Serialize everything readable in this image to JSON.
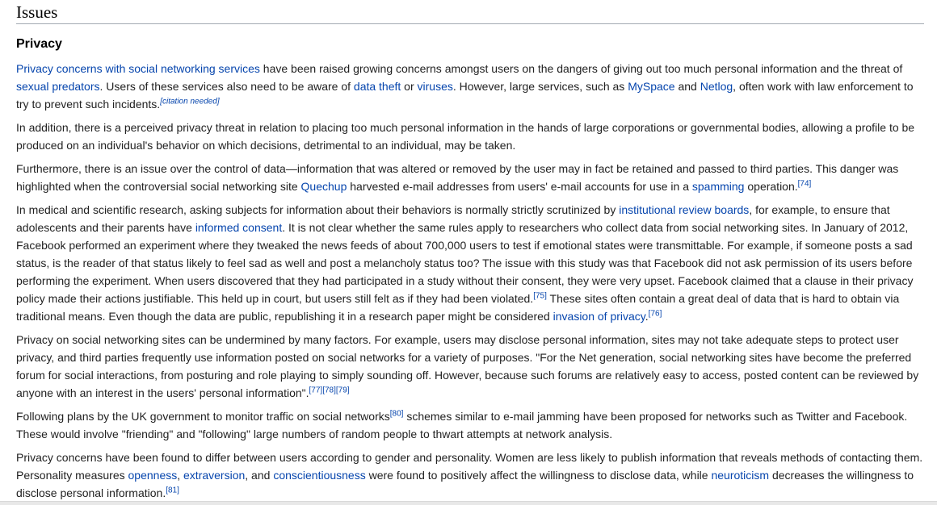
{
  "section_title": "Issues",
  "subsection_title": "Privacy",
  "p1": {
    "link1": "Privacy concerns with social networking services",
    "t1": " have been raised growing concerns amongst users on the dangers of giving out too much personal information and the threat of ",
    "link2": "sexual predators",
    "t2": ". Users of these services also need to be aware of ",
    "link3": "data theft",
    "t3": " or ",
    "link4": "viruses",
    "t4": ". However, large services, such as ",
    "link5": "MySpace",
    "t5": " and ",
    "link6": "Netlog",
    "t6": ", often work with law enforcement to try to prevent such incidents.",
    "cite_needed": "[citation needed]"
  },
  "p2": {
    "text": "In addition, there is a perceived privacy threat in relation to placing too much personal information in the hands of large corporations or governmental bodies, allowing a profile to be produced on an individual's behavior on which decisions, detrimental to an individual, may be taken."
  },
  "p3": {
    "t1": "Furthermore, there is an issue over the control of data—information that was altered or removed by the user may in fact be retained and passed to third parties. This danger was highlighted when the controversial social networking site ",
    "link1": "Quechup",
    "t2": " harvested e-mail addresses from users' e-mail accounts for use in a ",
    "link2": "spamming",
    "t3": " operation.",
    "ref1": "[74]"
  },
  "p4": {
    "t1": "In medical and scientific research, asking subjects for information about their behaviors is normally strictly scrutinized by ",
    "link1": "institutional review boards",
    "t2": ", for example, to ensure that adolescents and their parents have ",
    "link2": "informed consent",
    "t3": ". It is not clear whether the same rules apply to researchers who collect data from social networking sites. In January of 2012, Facebook performed an experiment where they tweaked the news feeds of about 700,000 users to test if emotional states were transmittable. For example, if someone posts a sad status, is the reader of that status likely to feel sad as well and post a melancholy status too? The issue with this study was that Facebook did not ask permission of its users before performing the experiment. When users discovered that they had participated in a study without their consent, they were very upset. Facebook claimed that a clause in their privacy policy made their actions justifiable. This held up in court, but users still felt as if they had been violated.",
    "ref1": "[75]",
    "t4": " These sites often contain a great deal of data that is hard to obtain via traditional means. Even though the data are public, republishing it in a research paper might be considered ",
    "link3": "invasion of privacy",
    "t5": ".",
    "ref2": "[76]"
  },
  "p5": {
    "t1": "Privacy on social networking sites can be undermined by many factors. For example, users may disclose personal information, sites may not take adequate steps to protect user privacy, and third parties frequently use information posted on social networks for a variety of purposes. \"For the Net generation, social networking sites have become the preferred forum for social interactions, from posturing and role playing to simply sounding off. However, because such forums are relatively easy to access, posted content can be reviewed by anyone with an interest in the users' personal information\".",
    "ref1": "[77]",
    "ref2": "[78]",
    "ref3": "[79]"
  },
  "p6": {
    "t1": "Following plans by the UK government to monitor traffic on social networks",
    "ref1": "[80]",
    "t2": " schemes similar to e-mail jamming have been proposed for networks such as Twitter and Facebook. These would involve \"friending\" and \"following\" large numbers of random people to thwart attempts at network analysis."
  },
  "p7": {
    "t1": "Privacy concerns have been found to differ between users according to gender and personality. Women are less likely to publish information that reveals methods of contacting them. Personality measures ",
    "link1": "openness",
    "t2": ", ",
    "link2": "extraversion",
    "t3": ", and ",
    "link3": "conscientiousness",
    "t4": " were found to positively affect the willingness to disclose data, while ",
    "link4": "neuroticism",
    "t5": " decreases the willingness to disclose personal information.",
    "ref1": "[81]"
  },
  "colors": {
    "link": "#0645ad",
    "text": "#222222",
    "heading_rule": "#a2a9b1"
  }
}
